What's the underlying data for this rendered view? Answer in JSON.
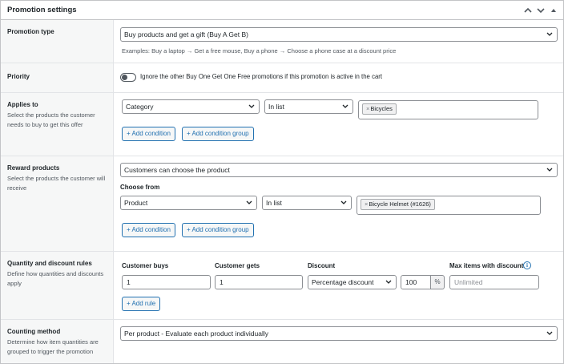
{
  "header": {
    "title": "Promotion settings",
    "icons": [
      "chevron-up-icon",
      "chevron-down-icon",
      "triangle-up-icon"
    ]
  },
  "promotion_type": {
    "label": "Promotion type",
    "value": "Buy products and get a gift (Buy A Get B)",
    "help": "Examples: Buy a laptop → Get a free mouse, Buy a phone → Choose a phone case at a discount price"
  },
  "priority": {
    "label": "Priority",
    "toggle_on": false,
    "text": "Ignore the other Buy One Get One Free promotions if this promotion is active in the cart"
  },
  "applies_to": {
    "label": "Applies to",
    "desc": "Select the products the customer needs to buy to get this offer",
    "field": "Category",
    "operator": "In list",
    "tag": "Bicycles",
    "add_condition": "+ Add condition",
    "add_group": "+ Add condition group"
  },
  "reward": {
    "label": "Reward products",
    "desc": "Select the products the customer will receive",
    "mode": "Customers can choose the product",
    "choose_from": "Choose from",
    "field": "Product",
    "operator": "In list",
    "tag": "Bicycle Helmet (#1626)",
    "add_condition": "+ Add condition",
    "add_group": "+ Add condition group"
  },
  "quantity": {
    "label": "Quantity and discount rules",
    "desc": "Define how quantities and discounts apply",
    "col_buys": "Customer buys",
    "col_gets": "Customer gets",
    "col_discount": "Discount",
    "col_max": "Max items with discount",
    "buys": "1",
    "gets": "1",
    "discount_type": "Percentage discount",
    "discount_value": "100",
    "discount_unit": "%",
    "max_placeholder": "Unlimited",
    "add_rule": "+ Add rule"
  },
  "counting": {
    "label": "Counting method",
    "desc": "Determine how item quantities are grouped to trigger the promotion",
    "value": "Per product - Evaluate each product individually"
  },
  "colors": {
    "accent": "#2271b1",
    "border": "#8c8f94",
    "label_bg": "#f6f7f7"
  }
}
